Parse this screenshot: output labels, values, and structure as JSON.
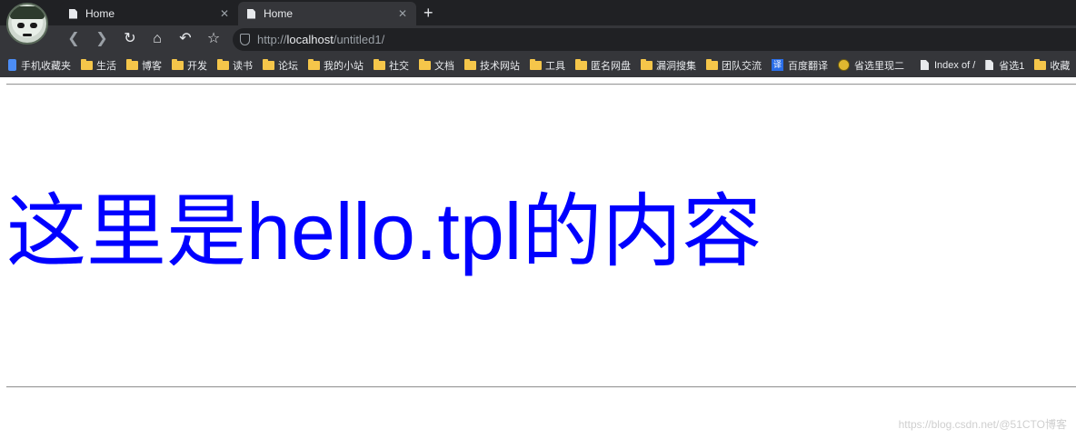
{
  "tabs": [
    {
      "title": "Home",
      "active": false
    },
    {
      "title": "Home",
      "active": true
    }
  ],
  "toolbar": {
    "url_scheme": "http://",
    "url_host": "localhost",
    "url_path": "/untitled1/"
  },
  "bookmarks": [
    {
      "label": "手机收藏夹",
      "icon": "phone-icon"
    },
    {
      "label": "生活",
      "icon": "folder-icon"
    },
    {
      "label": "博客",
      "icon": "folder-icon"
    },
    {
      "label": "开发",
      "icon": "folder-icon"
    },
    {
      "label": "读书",
      "icon": "folder-icon"
    },
    {
      "label": "论坛",
      "icon": "folder-icon"
    },
    {
      "label": "我的小站",
      "icon": "folder-icon"
    },
    {
      "label": "社交",
      "icon": "folder-icon"
    },
    {
      "label": "文档",
      "icon": "folder-icon"
    },
    {
      "label": "技术网站",
      "icon": "folder-icon"
    },
    {
      "label": "工具",
      "icon": "folder-icon"
    },
    {
      "label": "匿名网盘",
      "icon": "folder-icon"
    },
    {
      "label": "漏洞搜集",
      "icon": "folder-icon"
    },
    {
      "label": "团队交流",
      "icon": "folder-icon"
    },
    {
      "label": "百度翻译",
      "icon": "translate-icon"
    },
    {
      "label": "省选里现二",
      "icon": "face-icon"
    },
    {
      "label": "Index of /",
      "icon": "page-icon"
    },
    {
      "label": "省选1",
      "icon": "page-icon"
    },
    {
      "label": "收藏",
      "icon": "folder-icon"
    }
  ],
  "page": {
    "heading": "这里是hello.tpl的内容"
  },
  "watermark": "https://blog.csdn.net/@51CTO博客",
  "colors": {
    "heading": "#0000ff",
    "chrome_dark": "#202124",
    "chrome_mid": "#35363a"
  }
}
